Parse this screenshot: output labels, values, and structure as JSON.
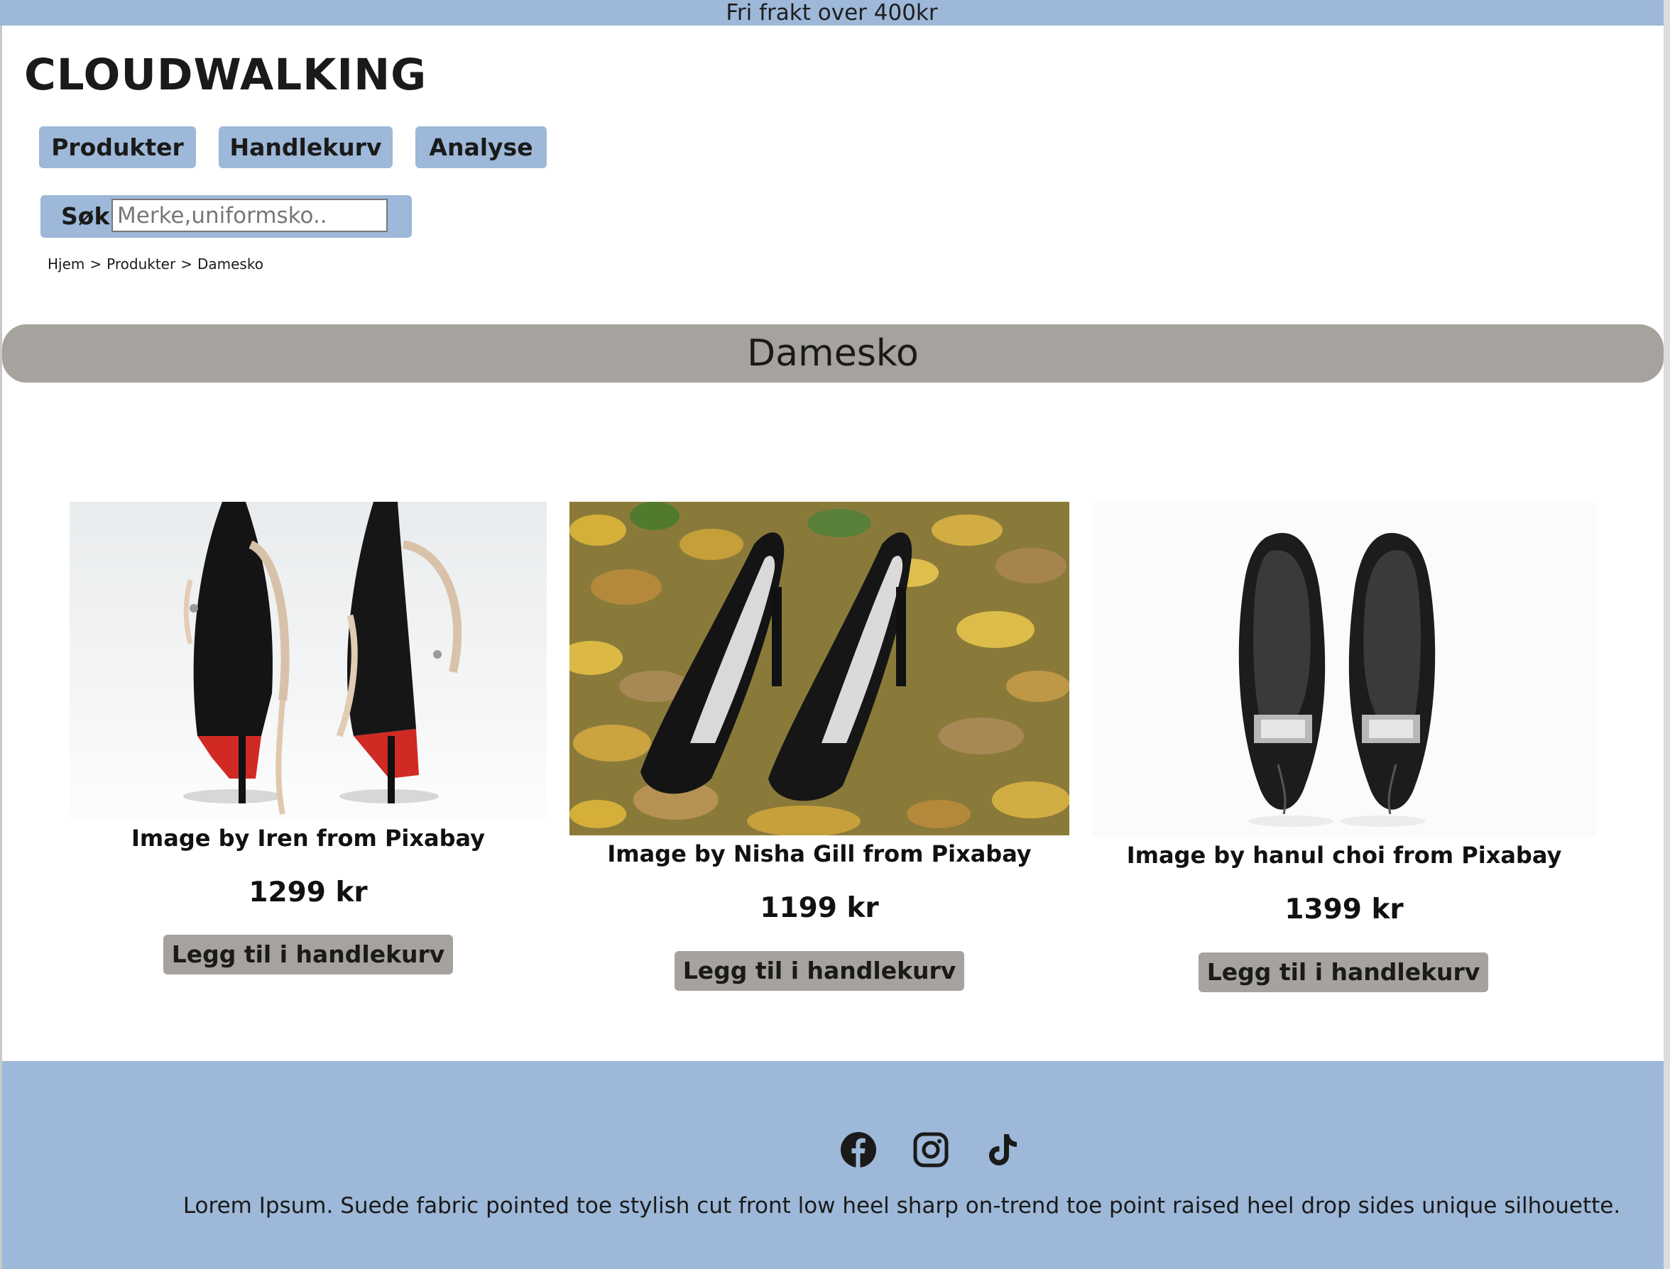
{
  "topbar": {
    "text": "Fri frakt over 400kr"
  },
  "header": {
    "logo": "CLOUDWALKING"
  },
  "nav": {
    "produkter": "Produkter",
    "handlekurv": "Handlekurv",
    "analyse": "Analyse"
  },
  "search": {
    "label": "Søk",
    "placeholder": "Merke,uniformsko..",
    "value": ""
  },
  "breadcrumb": {
    "items": [
      "Hjem",
      "Produkter",
      "Damesko"
    ],
    "separator": ">"
  },
  "category": {
    "title": "Damesko"
  },
  "products": [
    {
      "caption": "Image by Iren from Pixabay",
      "price": "1299 kr",
      "button": "Legg til i handlekurv"
    },
    {
      "caption": "Image by Nisha Gill from Pixabay",
      "price": "1199 kr",
      "button": "Legg til i handlekurv"
    },
    {
      "caption": "Image by hanul choi from Pixabay",
      "price": "1399 kr",
      "button": "Legg til i handlekurv"
    }
  ],
  "footer": {
    "social": [
      "facebook-icon",
      "instagram-icon",
      "tiktok-icon"
    ],
    "text": "Lorem Ipsum. Suede fabric pointed toe stylish cut front low heel sharp on-trend toe point raised heel drop sides unique silhouette."
  },
  "colors": {
    "accent": "#9db8d8",
    "neutral": "#a6a29d"
  }
}
